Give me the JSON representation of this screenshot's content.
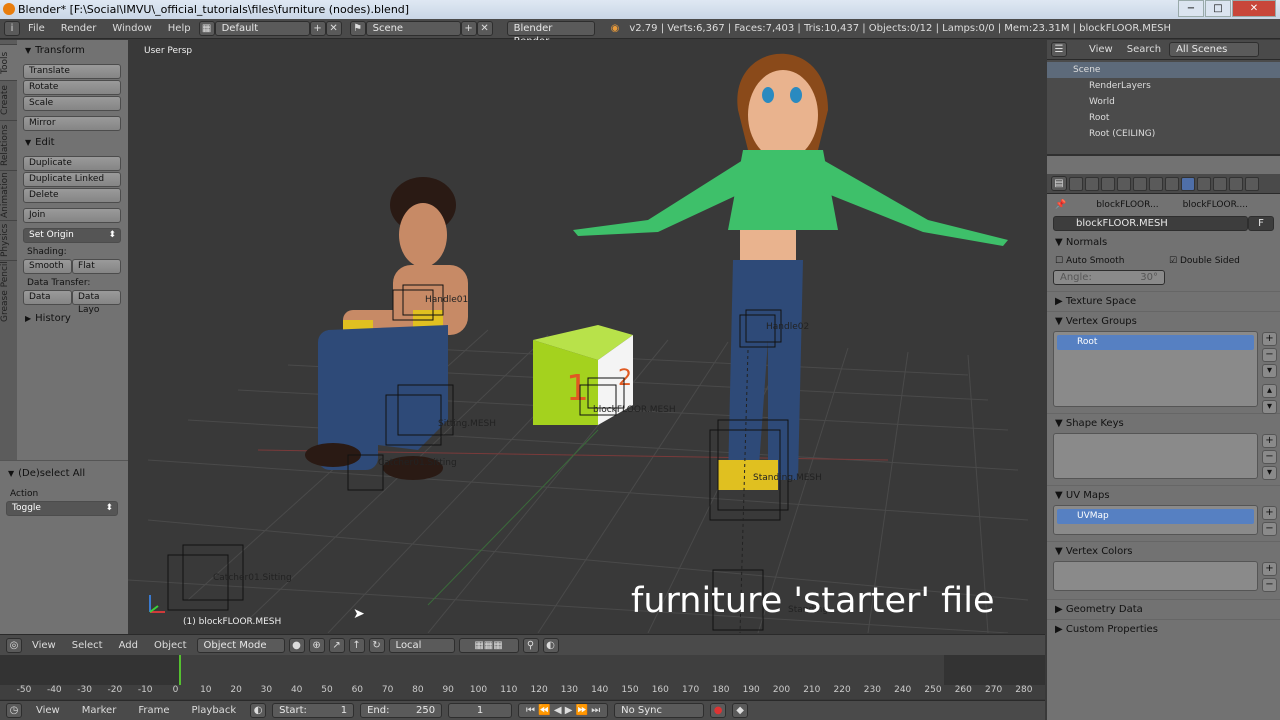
{
  "window": {
    "title": "Blender* [F:\\Social\\IMVU\\_official_tutorials\\files\\furniture (nodes).blend]",
    "btn_minimize": "−",
    "btn_maximize": "□",
    "btn_close": "✕"
  },
  "topbar": {
    "menus": [
      "File",
      "Render",
      "Window",
      "Help"
    ],
    "layout": "Default",
    "scene": "Scene",
    "engine": "Blender Render",
    "stats": "v2.79 | Verts:6,367 | Faces:7,403 | Tris:10,437 | Objects:0/12 | Lamps:0/0 | Mem:23.31M | blockFLOOR.MESH"
  },
  "tabs": [
    "Tools",
    "Create",
    "Relations",
    "Animation",
    "Physics",
    "Grease Pencil"
  ],
  "tools": {
    "transform_header": "Transform",
    "translate": "Translate",
    "rotate": "Rotate",
    "scale": "Scale",
    "mirror": "Mirror",
    "edit_header": "Edit",
    "duplicate": "Duplicate",
    "duplicate_linked": "Duplicate Linked",
    "delete": "Delete",
    "join": "Join",
    "set_origin": "Set Origin",
    "shading_label": "Shading:",
    "smooth": "Smooth",
    "flat": "Flat",
    "data_transfer_label": "Data Transfer:",
    "data": "Data",
    "data_layout": "Data Layo",
    "history": "History"
  },
  "operator": {
    "title": "(De)select All",
    "action_label": "Action",
    "action_value": "Toggle"
  },
  "viewport": {
    "view_label": "User Persp",
    "status": "(1) blockFLOOR.MESH",
    "overlay_text": "furniture 'starter' file",
    "labels": [
      "Handle01",
      "Handle02",
      "blockFLOOR.MESH",
      "Sitting.MESH",
      "Standing.MESH",
      "Catcher01.Sitting",
      "Catcher01.Sitting",
      "Standing"
    ]
  },
  "view_header": {
    "menus": [
      "View",
      "Select",
      "Add",
      "Object"
    ],
    "mode": "Object Mode",
    "orientation": "Local"
  },
  "timeline": {
    "ticks": [
      "-50",
      "-40",
      "-30",
      "-20",
      "-10",
      "0",
      "10",
      "20",
      "30",
      "40",
      "50",
      "60",
      "70",
      "80",
      "90",
      "100",
      "110",
      "120",
      "130",
      "140",
      "150",
      "160",
      "170",
      "180",
      "190",
      "200",
      "210",
      "220",
      "230",
      "240",
      "250",
      "260",
      "270",
      "280"
    ],
    "menus": [
      "View",
      "Marker",
      "Frame",
      "Playback"
    ],
    "start_label": "Start:",
    "start": "1",
    "end_label": "End:",
    "end": "250",
    "current": "1",
    "sync": "No Sync"
  },
  "outliner": {
    "menus": [
      "View",
      "Search"
    ],
    "filter": "All Scenes",
    "items": [
      "Scene",
      "RenderLayers",
      "World",
      "Root",
      "Root (CEILING)"
    ]
  },
  "properties": {
    "breadcrumb_1": "blockFLOOR...",
    "breadcrumb_2": "blockFLOOR....",
    "mesh_name": "blockFLOOR.MESH",
    "fake_user": "F",
    "normals": "Normals",
    "auto_smooth": "Auto Smooth",
    "double_sided": "Double Sided",
    "angle_label": "Angle:",
    "angle_value": "30°",
    "texture_space": "Texture Space",
    "vertex_groups": "Vertex Groups",
    "vg_item": "Root",
    "shape_keys": "Shape Keys",
    "uv_maps": "UV Maps",
    "uv_item": "UVMap",
    "vertex_colors": "Vertex Colors",
    "geometry_data": "Geometry Data",
    "custom_properties": "Custom Properties"
  }
}
